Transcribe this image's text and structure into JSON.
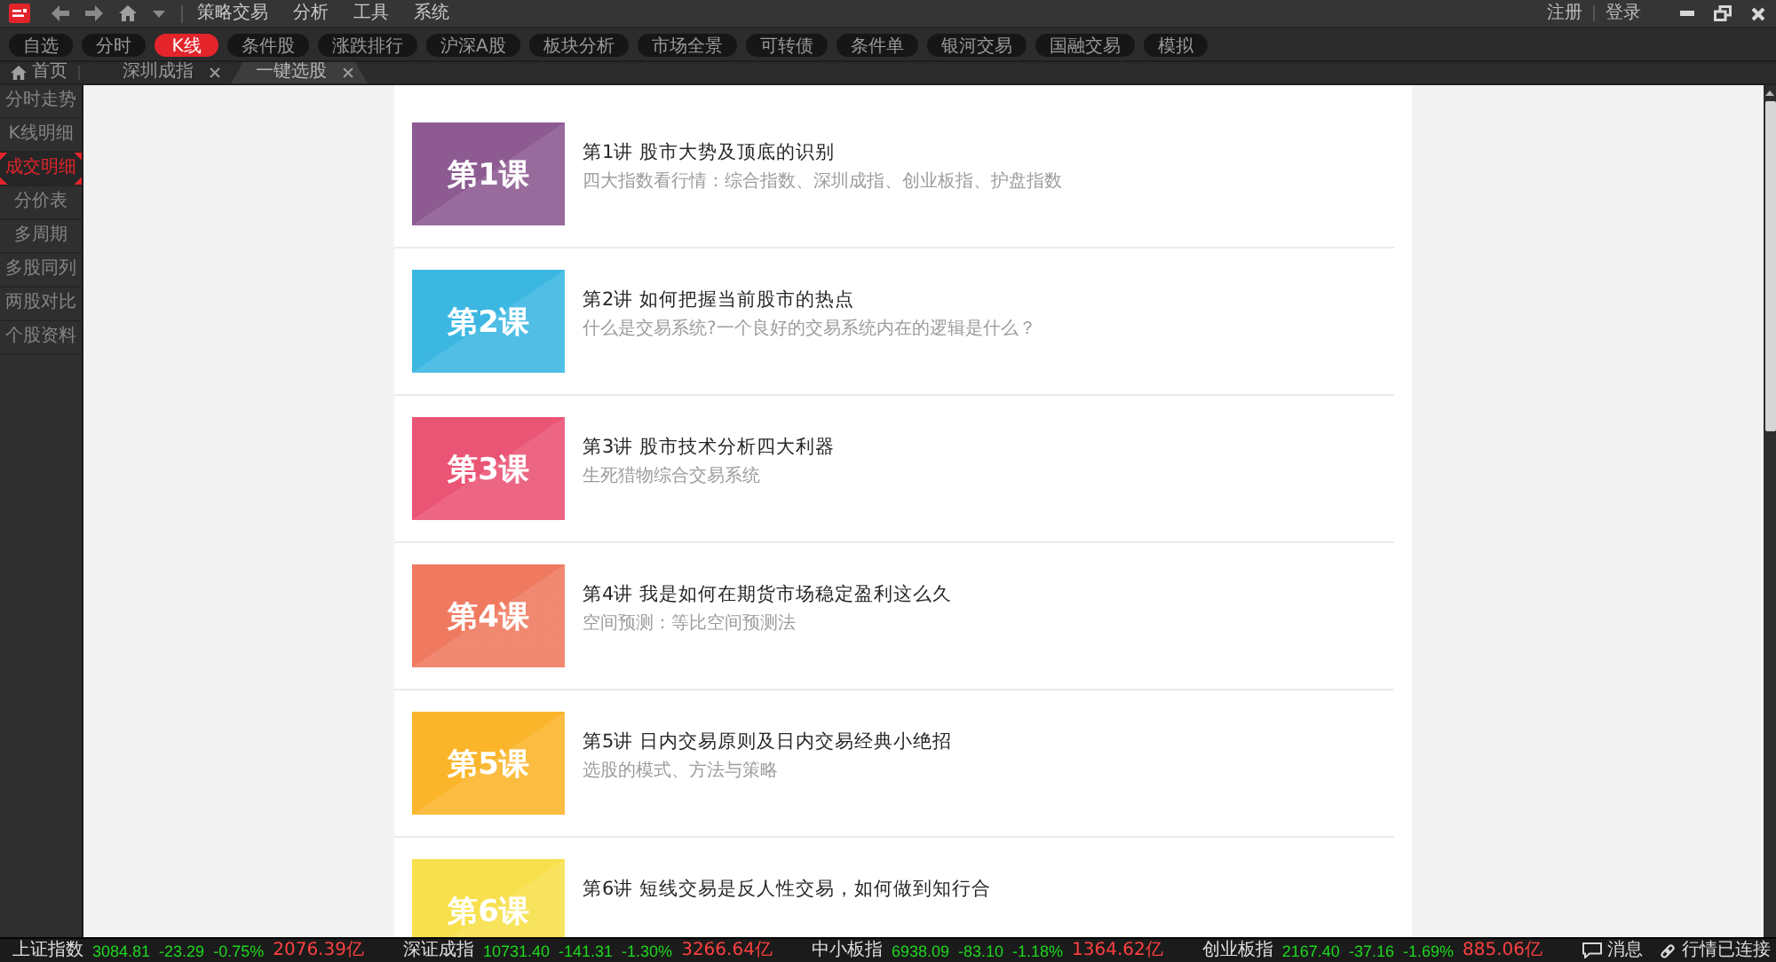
{
  "title_bar": {
    "menu": [
      "策略交易",
      "分析",
      "工具",
      "系统"
    ],
    "account_links": [
      "注册",
      "登录"
    ]
  },
  "toolbar": {
    "buttons": [
      {
        "label": "自选",
        "selected": false
      },
      {
        "label": "分时",
        "selected": false
      },
      {
        "label": "K线",
        "selected": true
      },
      {
        "label": "条件股",
        "selected": false
      },
      {
        "label": "涨跌排行",
        "selected": false
      },
      {
        "label": "沪深A股",
        "selected": false
      },
      {
        "label": "板块分析",
        "selected": false
      },
      {
        "label": "市场全景",
        "selected": false
      },
      {
        "label": "可转债",
        "selected": false
      },
      {
        "label": "条件单",
        "selected": false
      },
      {
        "label": "银河交易",
        "selected": false
      },
      {
        "label": "国融交易",
        "selected": false
      },
      {
        "label": "模拟",
        "selected": false
      }
    ]
  },
  "tabs": [
    {
      "kind": "home",
      "label": "首页",
      "selected": false
    },
    {
      "kind": "closable",
      "label": "深圳成指",
      "selected": false
    },
    {
      "kind": "closable",
      "label": "一键选股",
      "selected": true
    }
  ],
  "sidebar": {
    "items": [
      {
        "label": "分时走势",
        "selected": false
      },
      {
        "label": "K线明细",
        "selected": false
      },
      {
        "label": "成交明细",
        "selected": true
      },
      {
        "label": "分价表",
        "selected": false
      },
      {
        "label": "多周期",
        "selected": false
      },
      {
        "label": "多股同列",
        "selected": false
      },
      {
        "label": "两股对比",
        "selected": false
      },
      {
        "label": "个股资料",
        "selected": false
      }
    ]
  },
  "courses": [
    {
      "badge": "第1课",
      "color": "#8d5a92",
      "title": "第1讲 股市大势及顶底的识别",
      "subtitle": "四大指数看行情：综合指数、深圳成指、创业板指、护盘指数"
    },
    {
      "badge": "第2课",
      "color": "#3cb7e2",
      "title": "第2讲 如何把握当前股市的热点",
      "subtitle": "什么是交易系统?一个良好的交易系统内在的逻辑是什么？"
    },
    {
      "badge": "第3课",
      "color": "#ea5575",
      "title": "第3讲 股市技术分析四大利器",
      "subtitle": "生死猎物综合交易系统"
    },
    {
      "badge": "第4课",
      "color": "#ef7a60",
      "title": "第4讲 我是如何在期货市场稳定盈利这么久",
      "subtitle": "空间预测：等比空间预测法"
    },
    {
      "badge": "第5课",
      "color": "#fbb52b",
      "title": "第5讲 日内交易原则及日内交易经典小绝招",
      "subtitle": "选股的模式、方法与策略"
    },
    {
      "badge": "第6课",
      "color": "#f7e04b",
      "title": "第6讲 短线交易是反人性交易，如何做到知行合"
    }
  ],
  "status_bar": {
    "indices": [
      {
        "name": "上证指数",
        "value": "3084.81",
        "change": "-23.29",
        "percent": "-0.75%",
        "turnover": "2076.39亿",
        "rising": false
      },
      {
        "name": "深证成指",
        "value": "10731.40",
        "change": "-141.31",
        "percent": "-1.30%",
        "turnover": "3266.64亿",
        "rising": false
      },
      {
        "name": "中小板指",
        "value": "6938.09",
        "change": "-83.10",
        "percent": "-1.18%",
        "turnover": "1364.62亿",
        "rising": false
      },
      {
        "name": "创业板指",
        "value": "2167.40",
        "change": "-37.16",
        "percent": "-1.69%",
        "turnover": "885.06亿",
        "rising": false
      }
    ],
    "messages": "消息",
    "connection": "行情已连接"
  }
}
